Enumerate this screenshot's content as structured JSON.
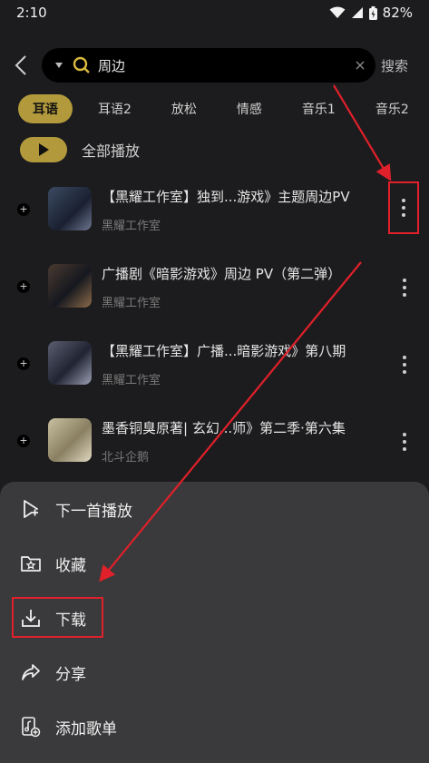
{
  "status": {
    "time": "2:10",
    "battery": "82%"
  },
  "search": {
    "query": "周边",
    "button": "搜索"
  },
  "tabs": [
    {
      "label": "耳语",
      "active": true
    },
    {
      "label": "耳语2"
    },
    {
      "label": "放松"
    },
    {
      "label": "情感"
    },
    {
      "label": "音乐1"
    },
    {
      "label": "音乐2"
    }
  ],
  "play_all": {
    "label": "全部播放"
  },
  "items": [
    {
      "title": "【黑耀工作室】独到...游戏》主题周边PV",
      "author": "黑耀工作室"
    },
    {
      "title": "广播剧《暗影游戏》周边 PV（第二弹）",
      "author": "黑耀工作室"
    },
    {
      "title": "【黑耀工作室】广播...暗影游戏》第八期",
      "author": "黑耀工作室"
    },
    {
      "title": "墨香铜臭原著| 玄幻...师》第二季·第六集",
      "author": "北斗企鹅"
    }
  ],
  "menu": [
    {
      "label": "下一首播放",
      "icon": "play-next-icon"
    },
    {
      "label": "收藏",
      "icon": "favorite-folder-icon"
    },
    {
      "label": "下载",
      "icon": "download-icon"
    },
    {
      "label": "分享",
      "icon": "share-icon"
    },
    {
      "label": "添加歌单",
      "icon": "add-playlist-icon"
    }
  ],
  "colors": {
    "accent": "#b29a3c",
    "highlight": "#e0202a",
    "sheet": "#3a3a3c"
  }
}
